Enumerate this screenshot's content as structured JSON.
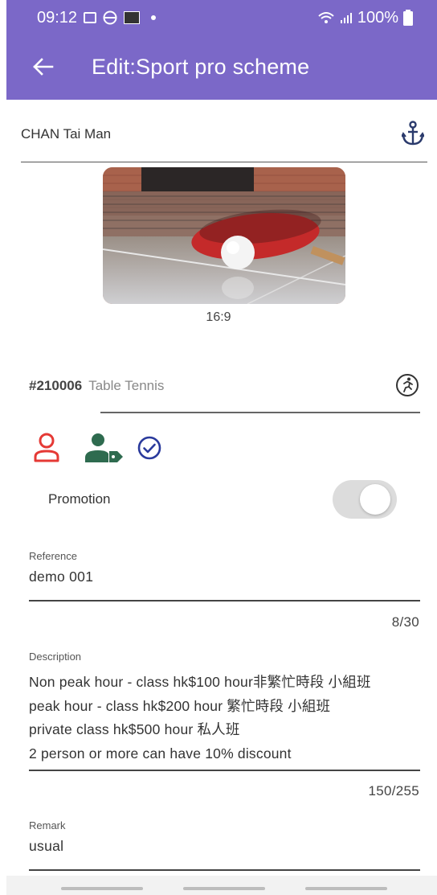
{
  "status_bar": {
    "time": "09:12",
    "battery": "100%"
  },
  "app_bar": {
    "title": "Edit:Sport pro scheme"
  },
  "user": {
    "name": "CHAN Tai Man"
  },
  "image": {
    "aspect_ratio": "16:9"
  },
  "scheme": {
    "code": "#210006",
    "sport": "Table Tennis"
  },
  "promotion": {
    "label": "Promotion",
    "enabled": false
  },
  "reference": {
    "label": "Reference",
    "value": "demo 001",
    "counter": "8/30"
  },
  "description": {
    "label": "Description",
    "lines": [
      "Non peak hour - class hk$100 hour非繁忙時段 小組班",
      "peak hour - class hk$200 hour 繁忙時段 小組班",
      "private class hk$500 hour 私人班",
      "2 person or more can have 10% discount"
    ],
    "counter": "150/255"
  },
  "remark": {
    "label": "Remark",
    "value": "usual"
  },
  "colors": {
    "app_bar": "#7b68c8",
    "person_icon": "#e53935",
    "member_icon": "#2e6b4f",
    "check_icon": "#2a3a9c"
  }
}
